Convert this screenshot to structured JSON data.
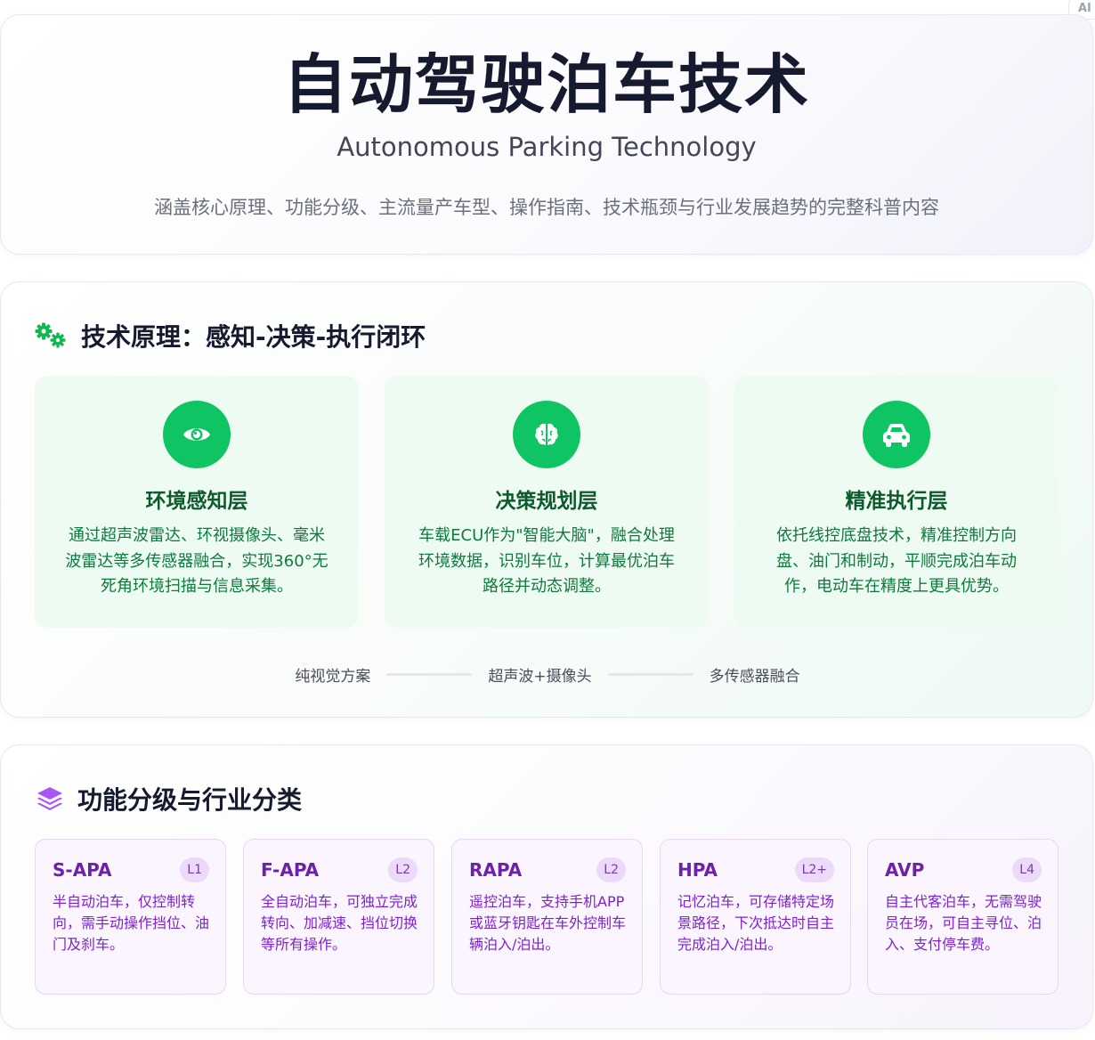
{
  "corner_badge": "AI",
  "hero": {
    "title": "自动驾驶泊车技术",
    "subtitle": "Autonomous Parking Technology",
    "description": "涵盖核心原理、功能分级、主流量产车型、操作指南、技术瓶颈与行业发展趋势的完整科普内容"
  },
  "principle": {
    "heading": "技术原理：感知-决策-执行闭环",
    "icon": "gears-icon",
    "cards": [
      {
        "icon": "eye-icon",
        "title": "环境感知层",
        "desc": "通过超声波雷达、环视摄像头、毫米波雷达等多传感器融合，实现360°无死角环境扫描与信息采集。"
      },
      {
        "icon": "brain-icon",
        "title": "决策规划层",
        "desc": "车载ECU作为\"智能大脑\"，融合处理环境数据，识别车位，计算最优泊车路径并动态调整。"
      },
      {
        "icon": "car-icon",
        "title": "精准执行层",
        "desc": "依托线控底盘技术，精准控制方向盘、油门和制动，平顺完成泊车动作，电动车在精度上更具优势。"
      }
    ],
    "schemes": [
      "纯视觉方案",
      "超声波+摄像头",
      "多传感器融合"
    ]
  },
  "levels": {
    "heading": "功能分级与行业分类",
    "icon": "layers-icon",
    "cards": [
      {
        "name": "S-APA",
        "badge": "L1",
        "desc": "半自动泊车，仅控制转向，需手动操作挡位、油门及刹车。"
      },
      {
        "name": "F-APA",
        "badge": "L2",
        "desc": "全自动泊车，可独立完成转向、加减速、挡位切换等所有操作。"
      },
      {
        "name": "RAPA",
        "badge": "L2",
        "desc": "遥控泊车，支持手机APP或蓝牙钥匙在车外控制车辆泊入/泊出。"
      },
      {
        "name": "HPA",
        "badge": "L2+",
        "desc": "记忆泊车，可存储特定场景路径，下次抵达时自主完成泊入/泊出。"
      },
      {
        "name": "AVP",
        "badge": "L4",
        "desc": "自主代客泊车，无需驾驶员在场，可自主寻位、泊入、支付停车费。"
      }
    ]
  },
  "colors": {
    "green_accent": "#0fc462",
    "purple_accent": "#a855f7",
    "title_dark": "#161a2e"
  }
}
